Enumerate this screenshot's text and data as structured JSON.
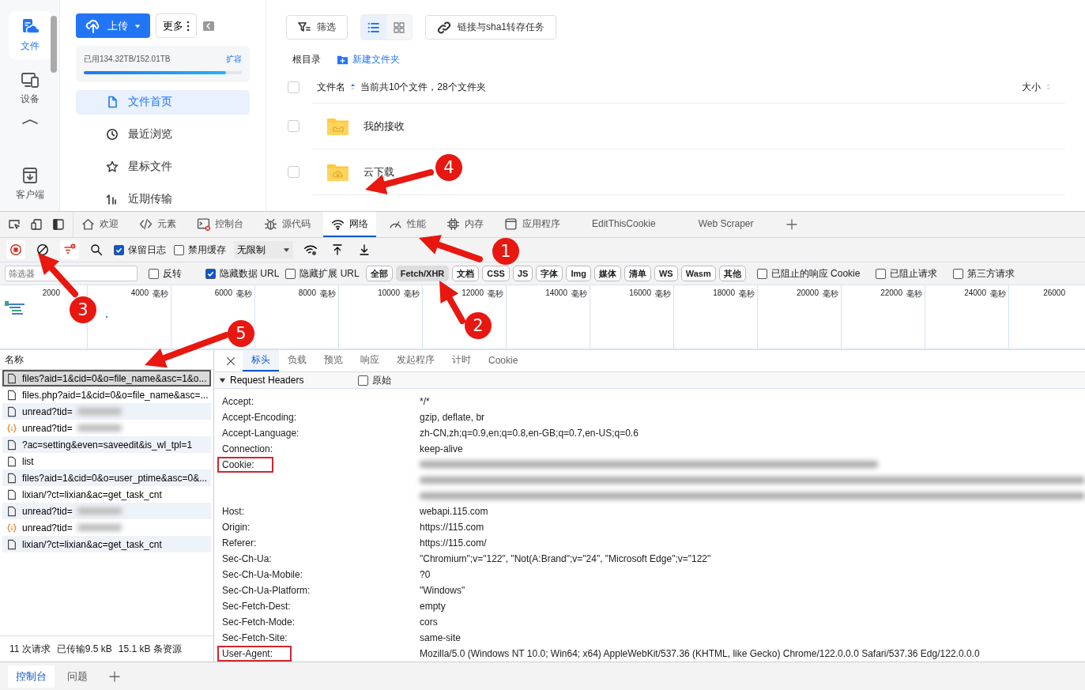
{
  "page": {
    "rail": {
      "items": [
        {
          "label": "文件",
          "kind": "files",
          "selected": true
        },
        {
          "label": "设备",
          "kind": "devices",
          "selected": false
        }
      ],
      "bottom_item": {
        "label": "客户端",
        "kind": "client"
      }
    },
    "nav": {
      "upload": "上传",
      "more": "更多",
      "storage": {
        "text": "已用134.32TB/152.01TB",
        "action": "扩容",
        "level": 0.9
      },
      "items": [
        {
          "label": "文件首页",
          "kind": "file",
          "selected": true
        },
        {
          "label": "最近浏览",
          "kind": "history",
          "selected": false
        },
        {
          "label": "星标文件",
          "kind": "star",
          "selected": false
        },
        {
          "label": "近期传输",
          "kind": "transfer",
          "selected": false
        }
      ]
    },
    "toolbar": {
      "filter": "筛选",
      "views": [
        {
          "kind": "list",
          "selected": true
        },
        {
          "kind": "grid",
          "selected": false
        }
      ],
      "link_task": "链接与sha1转存任务"
    },
    "breadcrumb": {
      "root": "根目录",
      "new_folder": "新建文件夹"
    },
    "select_all": {
      "checked": false
    },
    "columns": [
      {
        "label": "文件名",
        "sorted": true
      },
      {
        "label": "大小",
        "sorted": false
      }
    ],
    "summary": "当前共10个文件，28个文件夹",
    "files": [
      {
        "name": "我的接收",
        "kind": "inbox",
        "checked": false
      },
      {
        "name": "云下载",
        "kind": "cloud",
        "checked": false
      }
    ]
  },
  "devtools": {
    "tabs": [
      {
        "label": "欢迎",
        "kind": "welcome",
        "selected": false
      },
      {
        "label": "元素",
        "kind": "elements",
        "selected": false
      },
      {
        "label": "控制台",
        "kind": "console",
        "selected": false
      },
      {
        "label": "源代码",
        "kind": "sources",
        "selected": false
      },
      {
        "label": "网络",
        "kind": "network",
        "selected": true
      },
      {
        "label": "性能",
        "kind": "performance",
        "selected": false
      },
      {
        "label": "内存",
        "kind": "memory",
        "selected": false
      },
      {
        "label": "应用程序",
        "kind": "application",
        "selected": false
      },
      {
        "label": "EditThisCookie",
        "kind": "extension",
        "selected": false
      },
      {
        "label": "Web Scraper",
        "kind": "extension",
        "selected": false
      }
    ],
    "toolbar": {
      "recording": true,
      "options": [
        {
          "label": "保留日志",
          "checked": true
        },
        {
          "label": "禁用缓存",
          "checked": false
        }
      ],
      "throttle": "无限制"
    },
    "filter": {
      "placeholder": "筛选器",
      "options": [
        {
          "label": "反转",
          "checked": false
        },
        {
          "label": "隐藏数据 URL",
          "checked": true
        },
        {
          "label": "隐藏扩展 URL",
          "checked": false
        }
      ],
      "types": [
        {
          "label": "全部",
          "selected": false
        },
        {
          "label": "Fetch/XHR",
          "selected": true
        },
        {
          "label": "文档",
          "selected": false
        },
        {
          "label": "CSS",
          "selected": false
        },
        {
          "label": "JS",
          "selected": false
        },
        {
          "label": "字体",
          "selected": false
        },
        {
          "label": "Img",
          "selected": false
        },
        {
          "label": "媒体",
          "selected": false
        },
        {
          "label": "清单",
          "selected": false
        },
        {
          "label": "WS",
          "selected": false
        },
        {
          "label": "Wasm",
          "selected": false
        },
        {
          "label": "其他",
          "selected": false
        }
      ],
      "more_options": [
        {
          "label": "已阻止的响应 Cookie",
          "checked": false
        },
        {
          "label": "已阻止请求",
          "checked": false
        },
        {
          "label": "第三方请求",
          "checked": false
        }
      ]
    },
    "timeline": {
      "ticks": [
        {
          "value": "2000"
        },
        {
          "value": "4000",
          "unit": "毫秒"
        },
        {
          "value": "6000",
          "unit": "毫秒"
        },
        {
          "value": "8000",
          "unit": "毫秒"
        },
        {
          "value": "10000",
          "unit": "毫秒"
        },
        {
          "value": "12000",
          "unit": "毫秒"
        },
        {
          "value": "14000",
          "unit": "毫秒"
        },
        {
          "value": "16000",
          "unit": "毫秒"
        },
        {
          "value": "18000",
          "unit": "毫秒"
        },
        {
          "value": "20000",
          "unit": "毫秒"
        },
        {
          "value": "22000",
          "unit": "毫秒"
        },
        {
          "value": "24000",
          "unit": "毫秒"
        },
        {
          "value": "26000"
        }
      ]
    },
    "requests": {
      "header": "名称",
      "rows": [
        {
          "name": "files?aid=1&cid=0&o=file_name&asc=1&o...",
          "kind": "doc",
          "selected": true
        },
        {
          "name": "files.php?aid=1&cid=0&o=file_name&asc=...",
          "kind": "doc",
          "selected": false
        },
        {
          "name": "unread?tid=",
          "kind": "doc",
          "blurred": true,
          "selected": false
        },
        {
          "name": "unread?tid=",
          "kind": "script",
          "blurred": true,
          "selected": false
        },
        {
          "name": "?ac=setting&even=saveedit&is_wl_tpl=1",
          "kind": "doc",
          "selected": false
        },
        {
          "name": "list",
          "kind": "doc",
          "selected": false
        },
        {
          "name": "files?aid=1&cid=0&o=user_ptime&asc=0&...",
          "kind": "doc",
          "selected": false
        },
        {
          "name": "lixian/?ct=lixian&ac=get_task_cnt",
          "kind": "doc",
          "selected": false
        },
        {
          "name": "unread?tid=",
          "kind": "doc",
          "blurred": true,
          "selected": false
        },
        {
          "name": "unread?tid=",
          "kind": "script",
          "blurred": true,
          "selected": false
        },
        {
          "name": "lixian/?ct=lixian&ac=get_task_cnt",
          "kind": "doc",
          "selected": false
        }
      ],
      "status": [
        "11 次请求",
        "已传输9.5 kB",
        "15.1 kB 条资源"
      ]
    },
    "details": {
      "tabs": [
        {
          "label": "标头",
          "selected": true
        },
        {
          "label": "负载",
          "selected": false
        },
        {
          "label": "预览",
          "selected": false
        },
        {
          "label": "响应",
          "selected": false
        },
        {
          "label": "发起程序",
          "selected": false
        },
        {
          "label": "计时",
          "selected": false
        },
        {
          "label": "Cookie",
          "selected": false
        }
      ],
      "section": {
        "title": "Request Headers",
        "expanded": true,
        "raw": {
          "label": "原始",
          "checked": false
        }
      },
      "headers": [
        {
          "name": "Accept:",
          "value": "*/*",
          "highlighted": false,
          "blurred": false
        },
        {
          "name": "Accept-Encoding:",
          "value": "gzip, deflate, br",
          "highlighted": false,
          "blurred": false
        },
        {
          "name": "Accept-Language:",
          "value": "zh-CN,zh;q=0.9,en;q=0.8,en-GB;q=0.7,en-US;q=0.6",
          "highlighted": false,
          "blurred": false
        },
        {
          "name": "Connection:",
          "value": "keep-alive",
          "highlighted": false,
          "blurred": false
        },
        {
          "name": "Cookie:",
          "highlighted": true,
          "blurred": true
        },
        {
          "name": "Host:",
          "value": "webapi.115.com",
          "highlighted": false,
          "blurred": false
        },
        {
          "name": "Origin:",
          "value": "https://115.com",
          "highlighted": false,
          "blurred": false
        },
        {
          "name": "Referer:",
          "value": "https://115.com/",
          "highlighted": false,
          "blurred": false
        },
        {
          "name": "Sec-Ch-Ua:",
          "value": "\"Chromium\";v=\"122\", \"Not(A:Brand\";v=\"24\", \"Microsoft Edge\";v=\"122\"",
          "highlighted": false,
          "blurred": false
        },
        {
          "name": "Sec-Ch-Ua-Mobile:",
          "value": "?0",
          "highlighted": false,
          "blurred": false
        },
        {
          "name": "Sec-Ch-Ua-Platform:",
          "value": "\"Windows\"",
          "highlighted": false,
          "blurred": false
        },
        {
          "name": "Sec-Fetch-Dest:",
          "value": "empty",
          "highlighted": false,
          "blurred": false
        },
        {
          "name": "Sec-Fetch-Mode:",
          "value": "cors",
          "highlighted": false,
          "blurred": false
        },
        {
          "name": "Sec-Fetch-Site:",
          "value": "same-site",
          "highlighted": false,
          "blurred": false
        },
        {
          "name": "User-Agent:",
          "value": "Mozilla/5.0 (Windows NT 10.0; Win64; x64) AppleWebKit/537.36 (KHTML, like Gecko) Chrome/122.0.0.0 Safari/537.36 Edg/122.0.0.0",
          "highlighted": true,
          "blurred": false
        }
      ]
    },
    "drawer": {
      "tabs": [
        {
          "label": "控制台",
          "selected": true
        },
        {
          "label": "问题",
          "selected": false
        }
      ]
    }
  },
  "annotations": [
    {
      "number": "1"
    },
    {
      "number": "2"
    },
    {
      "number": "3"
    },
    {
      "number": "4"
    },
    {
      "number": "5"
    }
  ]
}
